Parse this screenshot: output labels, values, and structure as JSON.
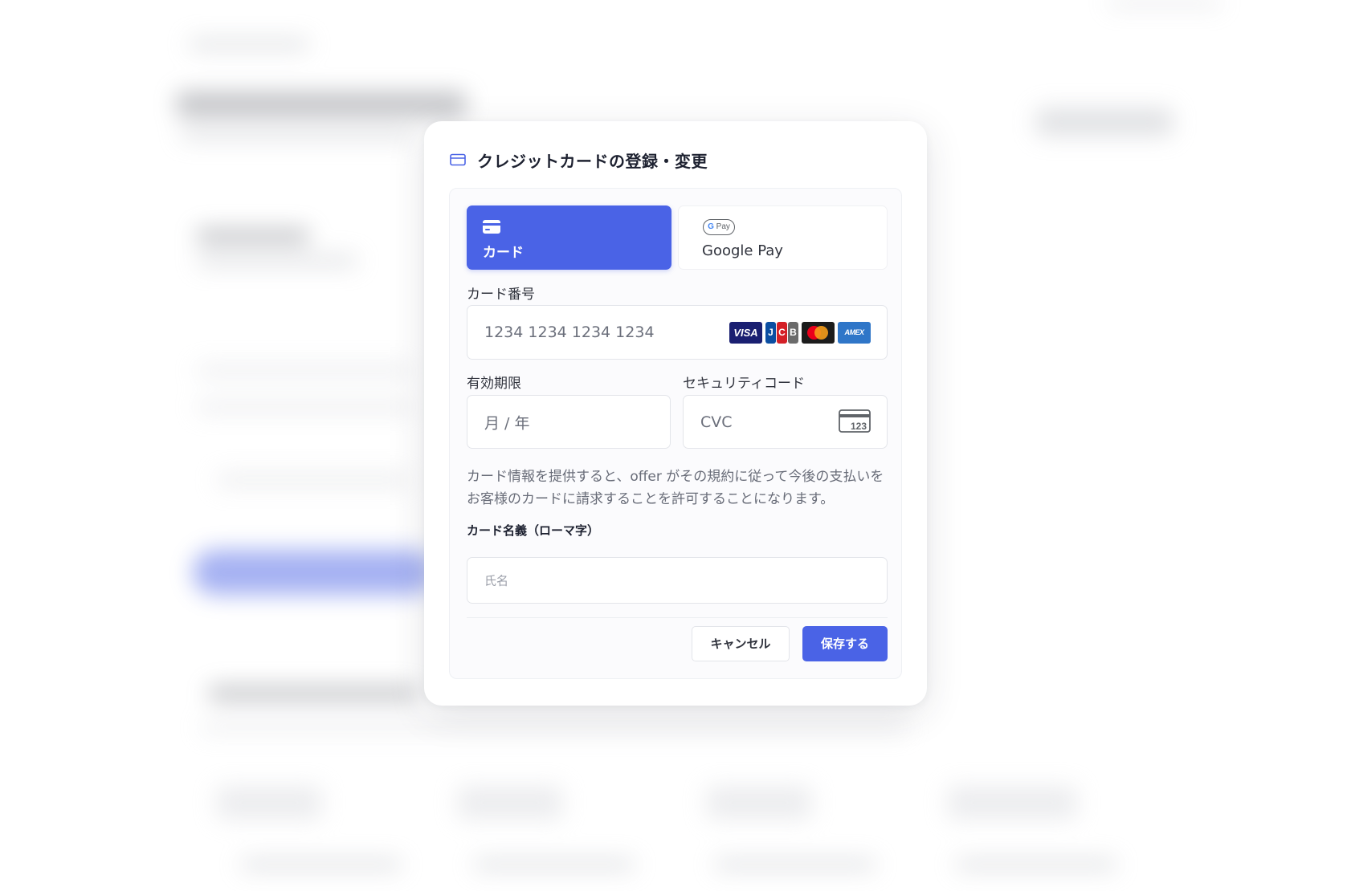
{
  "modal": {
    "title": "クレジットカードの登録・変更",
    "tabs": [
      {
        "label": "カード",
        "selected": true
      },
      {
        "label": "Google Pay",
        "badge_prefix": "G",
        "badge_text": "Pay",
        "selected": false
      }
    ],
    "card_number": {
      "label": "カード番号",
      "placeholder": "1234 1234 1234 1234",
      "brands": [
        "VISA",
        "JCB",
        "Mastercard",
        "AMEX"
      ],
      "visa_text": "VISA",
      "jcb_letters": [
        "J",
        "C",
        "B"
      ],
      "amex_text": "AMEX"
    },
    "expiry": {
      "label": "有効期限",
      "placeholder": "月 / 年"
    },
    "cvc": {
      "label": "セキュリティコード",
      "placeholder": "CVC",
      "icon_text": "123"
    },
    "notice": "カード情報を提供すると、offer がその規約に従って今後の支払いをお客様のカードに請求することを許可することになります。",
    "cardholder": {
      "label": "カード名義（ローマ字）",
      "placeholder": "氏名"
    },
    "buttons": {
      "cancel": "キャンセル",
      "save": "保存する"
    },
    "colors": {
      "accent": "#4a63e6"
    }
  }
}
